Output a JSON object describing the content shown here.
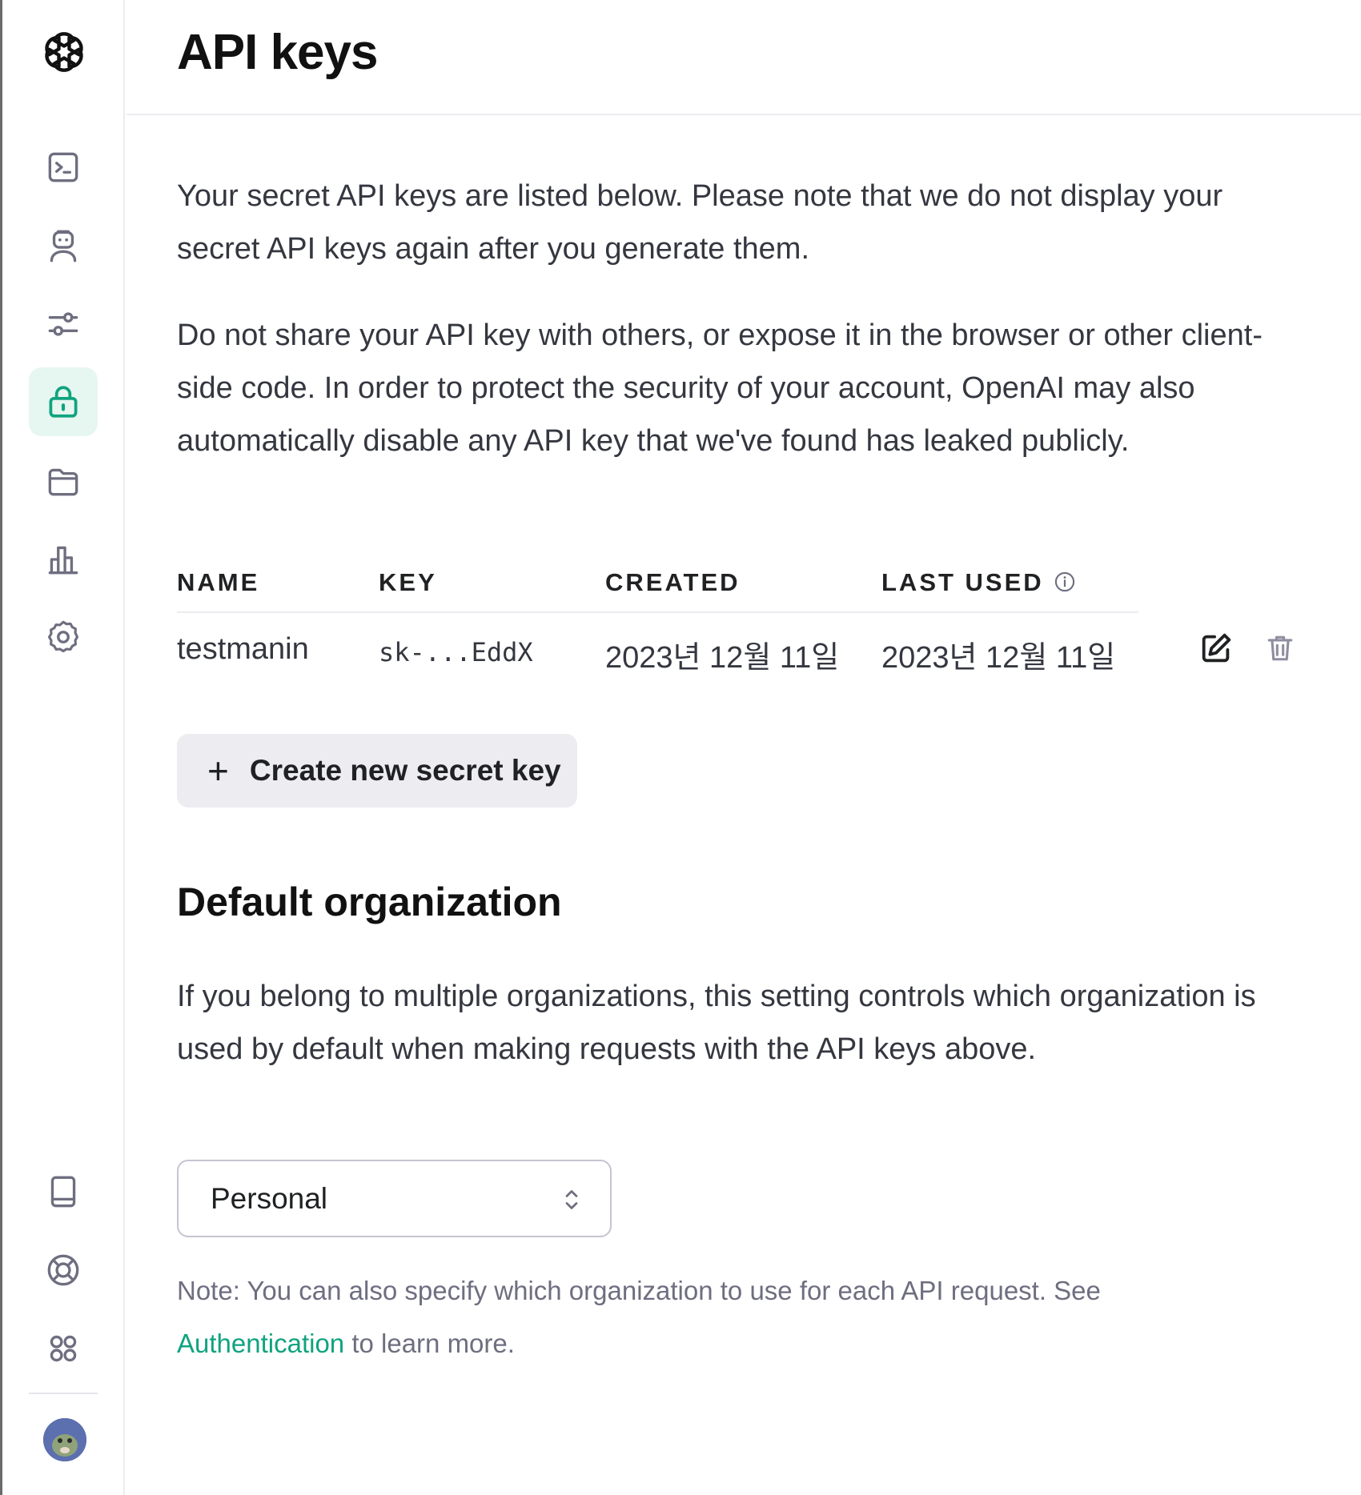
{
  "page": {
    "title": "API keys",
    "intro": "Your secret API keys are listed below. Please note that we do not display your secret API keys again after you generate them.",
    "warning": "Do not share your API key with others, or expose it in the browser or other client-side code. In order to protect the security of your account, OpenAI may also automatically disable any API key that we've found has leaked publicly."
  },
  "sidebar": {
    "items": [
      {
        "icon": "terminal-icon",
        "active": false
      },
      {
        "icon": "assistant-bot-icon",
        "active": false
      },
      {
        "icon": "sliders-icon",
        "active": false
      },
      {
        "icon": "lock-icon",
        "active": true
      },
      {
        "icon": "folder-icon",
        "active": false
      },
      {
        "icon": "bar-chart-icon",
        "active": false
      },
      {
        "icon": "gear-icon",
        "active": false
      }
    ],
    "bottom_items": [
      {
        "icon": "book-icon"
      },
      {
        "icon": "lifebuoy-icon"
      },
      {
        "icon": "apps-grid-icon"
      }
    ],
    "accent_color": "#10a37f"
  },
  "keys_table": {
    "headers": {
      "name": "NAME",
      "key": "KEY",
      "created": "CREATED",
      "last_used": "LAST USED"
    },
    "rows": [
      {
        "name": "testmanin",
        "key": "sk-...EddX",
        "created": "2023년 12월 11일",
        "last_used": "2023년 12월 11일"
      }
    ]
  },
  "create_button": {
    "icon": "plus-icon",
    "label": "Create new secret key"
  },
  "default_org": {
    "title": "Default organization",
    "description": "If you belong to multiple organizations, this setting controls which organization is used by default when making requests with the API keys above.",
    "selected": "Personal",
    "note_prefix": "Note: You can also specify which organization to use for each API request. See",
    "note_link": "Authentication",
    "note_suffix": "to learn more."
  }
}
